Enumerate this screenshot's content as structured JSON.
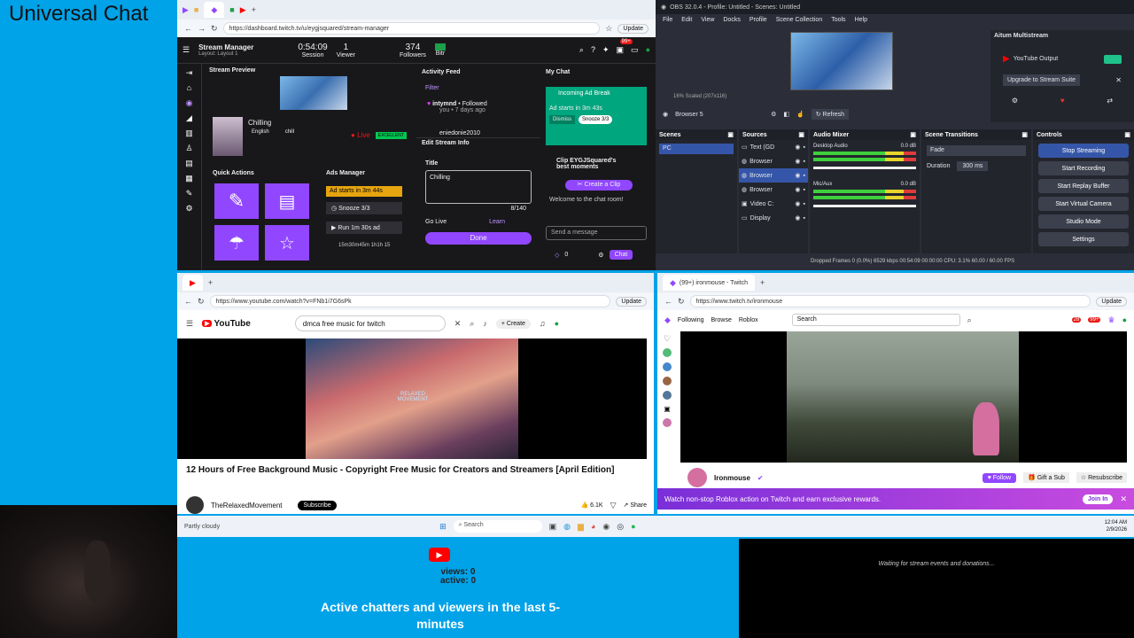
{
  "universal_chat": {
    "title": "Universal Chat"
  },
  "twitch_dashboard": {
    "tab_label": "",
    "url": "https://dashboard.twitch.tv/u/eygjsquared/stream-manager",
    "update_label": "Update",
    "brand": "Stream Manager",
    "layout": "Layout: Layout 1",
    "session_value": "0:54:09",
    "session_label": "Session",
    "viewer_value": "1",
    "viewer_label": "Viewer",
    "followers_value": "374",
    "followers_label": "Followers",
    "bitrate_label": "Bitr",
    "badge": "99+",
    "stream_preview": "Stream Preview",
    "stream_title": "Chilling",
    "tag1": "English",
    "tag2": "chill",
    "live": "Live",
    "quality": "EXCELLENT",
    "quick_actions": "Quick Actions",
    "ads_manager": "Ads Manager",
    "ads_in": "Ad starts in  3m 44s",
    "snooze": "Snooze 3/3",
    "run_ad": "Run 1m 30s ad",
    "ad_times": "15m30m45m 1h1h 15",
    "activity_feed": "Activity Feed",
    "filter": "Filter",
    "follow_user": "intymnd",
    "follow_text": "• Followed",
    "follow_sub": "you • 7 days ago",
    "next_user": "eniedonie2010",
    "edit_info": "Edit Stream Info",
    "title_label": "Title",
    "title_value": "Chilling",
    "char_count": "8/140",
    "go_live": "Go Live",
    "learn": "Learn",
    "done": "Done",
    "my_chat": "My Chat",
    "incoming_ad": "Incoming Ad Break",
    "ad_starts": "Ad starts in 3m 43s",
    "dismiss": "Dismiss",
    "snooze2": "Snooze 3/3",
    "clip_title": "Clip EYGJSquared's best moments",
    "create_clip": "Create a Clip",
    "welcome": "Welcome to the chat room!",
    "send_placeholder": "Send a message",
    "points": "0",
    "chat_btn": "Chat"
  },
  "obs": {
    "title": "OBS 32.0.4 - Profile: Untitled - Scenes: Untitled",
    "menu": [
      "File",
      "Edit",
      "View",
      "Docks",
      "Profile",
      "Scene Collection",
      "Tools",
      "Help"
    ],
    "preview_label": "16%  Scaled (207x116)",
    "multistream": "Aitum Multistream",
    "yt_output": "YouTube Output",
    "upgrade": "Upgrade to Stream Suite",
    "source_sel": "Browser 5",
    "refresh": "Refresh",
    "scenes_h": "Scenes",
    "scene_item": "PC",
    "sources_h": "Sources",
    "sources": [
      "Text (GD",
      "Browser",
      "Browser",
      "Browser",
      "Video C:",
      "Display"
    ],
    "mixer_h": "Audio Mixer",
    "desktop": "Desktop Audio",
    "desktop_db": "0.0 dB",
    "mic": "Mic/Aux",
    "mic_db": "0.0 dB",
    "trans_h": "Scene Transitions",
    "trans_val": "Fade",
    "duration_lbl": "Duration",
    "duration_val": "300 ms",
    "controls_h": "Controls",
    "controls": [
      "Stop Streaming",
      "Start Recording",
      "Start Replay Buffer",
      "Start Virtual Camera",
      "Studio Mode",
      "Settings"
    ],
    "status": "Dropped Frames 0 (0.0%)   6529 kbps   00:54:09   00:00:00   CPU: 3.1%   60.00 / 60.00 FPS"
  },
  "youtube": {
    "url": "https://www.youtube.com/watch?v=FNb1i7G6sPk",
    "update_label": "Update",
    "logo": "YouTube",
    "search": "dmca free music for twitch",
    "create": "Create",
    "video_title": "12 Hours of Free Background Music - Copyright Free Music for Creators and Streamers [April Edition]",
    "channel": "TheRelaxedMovement",
    "subscribe": "Subscribe",
    "likes": "6.1K",
    "share": "Share",
    "watermark": "RELAXED MOVEMENT"
  },
  "twitch_channel": {
    "tab": "(99+) ironmouse - Twitch",
    "url": "https://www.twitch.tv/ironmouse",
    "update_label": "Update",
    "nav": [
      "Following",
      "Browse",
      "Roblox"
    ],
    "search": "Search",
    "notif1": "28",
    "notif2": "99+",
    "streamer": "Ironmouse",
    "follow": "Follow",
    "gift": "Gift a Sub",
    "resub": "Resubscribe",
    "banner": "Watch non-stop Roblox action on Twitch and earn exclusive rewards.",
    "join": "Join In"
  },
  "taskbar": {
    "weather": "Partly cloudy",
    "search": "Search",
    "time": "12:04 AM",
    "date": "2/9/2026"
  },
  "overlay": {
    "views": "views: 0",
    "active": "active: 0",
    "caption": "Active chatters and viewers in the last 5-minutes",
    "waiting": "Waiting for stream events and donations..."
  }
}
